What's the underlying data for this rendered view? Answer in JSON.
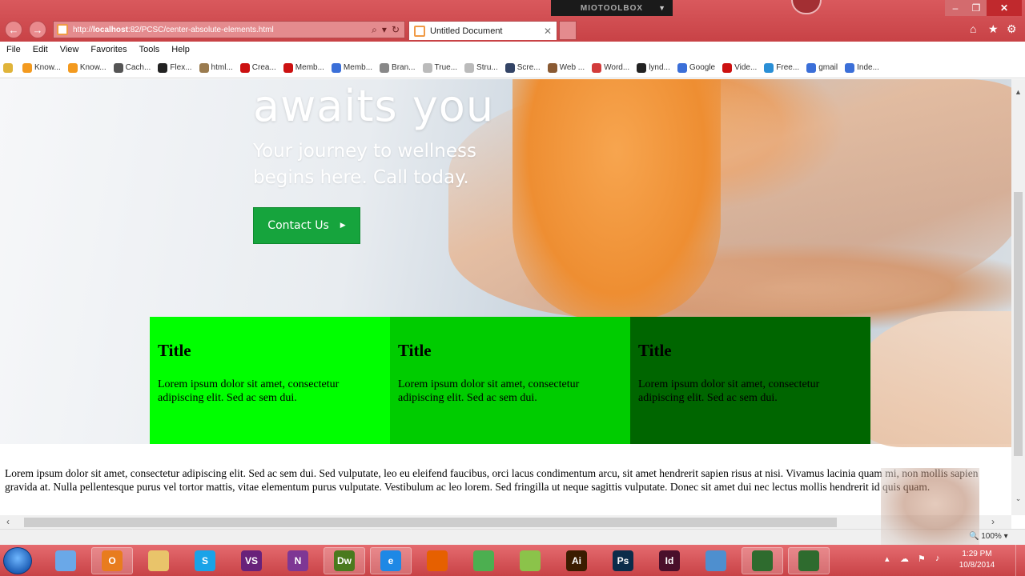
{
  "browser": {
    "url_prefix": "http://",
    "url_host": "localhost",
    "url_rest": ":82/PCSC/center-absolute-elements.html",
    "tab_title": "Untitled Document",
    "tool_overlay": "MIOTOOLBOX"
  },
  "menu": [
    "File",
    "Edit",
    "View",
    "Favorites",
    "Tools",
    "Help"
  ],
  "favorites": [
    {
      "label": "Know...",
      "icon": "orange-circle-icon",
      "color": "#f39a1f"
    },
    {
      "label": "Know...",
      "icon": "orange-circle-icon",
      "color": "#f39a1f"
    },
    {
      "label": "Cach...",
      "icon": "star-icon",
      "color": "#555555"
    },
    {
      "label": "Flex...",
      "icon": "bird-icon",
      "color": "#222222"
    },
    {
      "label": "html...",
      "icon": "page-icon",
      "color": "#9a7b4f"
    },
    {
      "label": "Crea...",
      "icon": "youtube-icon",
      "color": "#cc1111"
    },
    {
      "label": "Memb...",
      "icon": "youtube-icon",
      "color": "#cc1111"
    },
    {
      "label": "Memb...",
      "icon": "m-icon",
      "color": "#3b6fd8"
    },
    {
      "label": "Bran...",
      "icon": "gear-icon",
      "color": "#888888"
    },
    {
      "label": "True...",
      "icon": "page-icon",
      "color": "#bbbbbb"
    },
    {
      "label": "Stru...",
      "icon": "folder-icon",
      "color": "#bbbbbb"
    },
    {
      "label": "Scre...",
      "icon": "globe-icon",
      "color": "#334466"
    },
    {
      "label": "Web ...",
      "icon": "image-icon",
      "color": "#8a5a33"
    },
    {
      "label": "Word...",
      "icon": "flower-icon",
      "color": "#d23b3b"
    },
    {
      "label": "lynd...",
      "icon": "lynda-icon",
      "color": "#222222"
    },
    {
      "label": "Google",
      "icon": "google-icon",
      "color": "#3b6fd8"
    },
    {
      "label": "Vide...",
      "icon": "youtube-icon",
      "color": "#cc1111"
    },
    {
      "label": "Free...",
      "icon": "twitter-icon",
      "color": "#2a8fd6"
    },
    {
      "label": "gmail",
      "icon": "google-icon",
      "color": "#3b6fd8"
    },
    {
      "label": "Inde...",
      "icon": "page-icon",
      "color": "#3b6fd8"
    }
  ],
  "hero": {
    "headline": "awaits you",
    "subline": "Your journey to wellness begins here. Call today.",
    "cta": "Contact Us",
    "cta_color": "#16a43d"
  },
  "cards": [
    {
      "title": "Title",
      "text": "Lorem ipsum dolor sit amet, consectetur adipiscing elit. Sed ac sem dui.",
      "color": "#00ff00"
    },
    {
      "title": "Title",
      "text": "Lorem ipsum dolor sit amet, consectetur adipiscing elit. Sed ac sem dui.",
      "color": "#00cc00"
    },
    {
      "title": "Title",
      "text": "Lorem ipsum dolor sit amet, consectetur adipiscing elit. Sed ac sem dui.",
      "color": "#006600"
    }
  ],
  "body_text": "Lorem ipsum dolor sit amet, consectetur adipiscing elit. Sed ac sem dui. Sed vulputate, leo eu eleifend faucibus, orci lacus condimentum arcu, sit amet hendrerit sapien risus at nisi. Vivamus lacinia quam mi, non mollis sapien gravida at. Nulla pellentesque purus vel tortor mattis, vitae elementum purus vulputate. Vestibulum ac leo lorem. Sed fringilla ut neque sagittis vulputate. Donec sit amet dui nec lectus mollis hendrerit id quis quam.",
  "status": {
    "zoom": "100%"
  },
  "taskbar": {
    "apps": [
      {
        "name": "taskbar-app-gem",
        "label": "",
        "color": "#6aa8e8"
      },
      {
        "name": "taskbar-app-outlook",
        "label": "O",
        "color": "#e87c1e"
      },
      {
        "name": "taskbar-app-explorer",
        "label": "",
        "color": "#e9c46a"
      },
      {
        "name": "taskbar-app-skype",
        "label": "S",
        "color": "#1aa3e8"
      },
      {
        "name": "taskbar-app-visual-studio",
        "label": "VS",
        "color": "#68217a"
      },
      {
        "name": "taskbar-app-onenote",
        "label": "N",
        "color": "#7e3794"
      },
      {
        "name": "taskbar-app-dreamweaver",
        "label": "Dw",
        "color": "#4a7a1e"
      },
      {
        "name": "taskbar-app-ie",
        "label": "e",
        "color": "#1e88e5"
      },
      {
        "name": "taskbar-app-firefox",
        "label": "",
        "color": "#e66000"
      },
      {
        "name": "taskbar-app-chrome",
        "label": "",
        "color": "#4caf50"
      },
      {
        "name": "taskbar-app-photo",
        "label": "",
        "color": "#8bc34a"
      },
      {
        "name": "taskbar-app-illustrator",
        "label": "Ai",
        "color": "#3b1c00"
      },
      {
        "name": "taskbar-app-photoshop",
        "label": "Ps",
        "color": "#0b2c4a"
      },
      {
        "name": "taskbar-app-indesign",
        "label": "Id",
        "color": "#4a0f2b"
      },
      {
        "name": "taskbar-app-tool1",
        "label": "",
        "color": "#4e8fcf"
      },
      {
        "name": "taskbar-app-tool2",
        "label": "",
        "color": "#2e6b2e"
      },
      {
        "name": "taskbar-app-tool3",
        "label": "",
        "color": "#2e6b2e"
      }
    ],
    "time": "1:29 PM",
    "date": "10/8/2014"
  }
}
